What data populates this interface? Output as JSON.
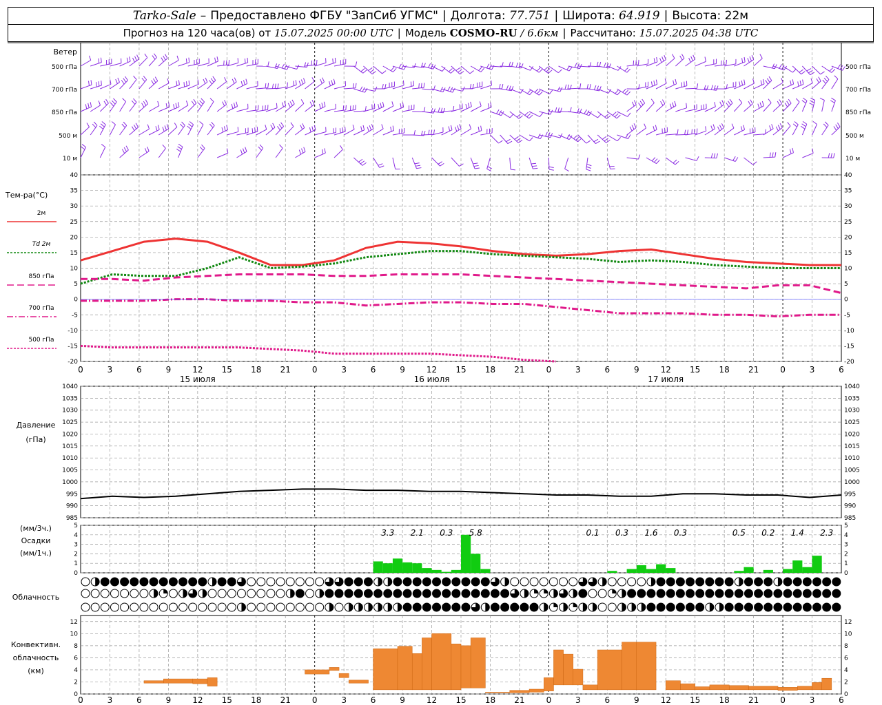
{
  "header": {
    "station": "Tarko-Sale",
    "dash": "–",
    "provider": "Предоставлено ФГБУ \"ЗапСиб УГМС\"",
    "lon_label": "Долгота:",
    "lon_value": "77.751",
    "lat_label": "Широта:",
    "lat_value": "64.919",
    "alt_label": "Высота:",
    "alt_value": "22м",
    "forecast_prefix": "Прогноз на 120 часа(ов) от",
    "forecast_start": "15.07.2025 00:00 UTC",
    "model_label": "Модель",
    "model_name": "COSMO-RU",
    "model_res": "/ 6.6км",
    "calc_label": "Рассчитано:",
    "calc_time": "15.07.2025 04:38 UTC"
  },
  "chart_data": [
    {
      "type": "barbs",
      "title": "Ветер",
      "levels": [
        "500 гПа",
        "700 гПа",
        "850 гПа",
        "500 м",
        "10 м"
      ],
      "color": "#8a2be2"
    },
    {
      "type": "line",
      "title": "Тем-ра(°С)",
      "ylim": [
        -20,
        40
      ],
      "yticks": [
        40,
        35,
        30,
        25,
        20,
        15,
        10,
        5,
        0,
        -5,
        -10,
        -15,
        -20
      ],
      "x": [
        0,
        3,
        6,
        9,
        12,
        15,
        18,
        21,
        24,
        27,
        30,
        33,
        36,
        39,
        42,
        45,
        48,
        51,
        54,
        57,
        60,
        63,
        66,
        69,
        72
      ],
      "series": [
        {
          "name": "2м",
          "color": "#ee3333",
          "style": "solid",
          "values": [
            12.5,
            15.5,
            18.5,
            19.5,
            18.5,
            15.0,
            11.0,
            11.0,
            12.5,
            16.5,
            18.5,
            18.0,
            17.0,
            15.5,
            14.5,
            14.0,
            14.5,
            15.5,
            16.0,
            14.5,
            13.0,
            12.0,
            11.5,
            11.0,
            11.0
          ]
        },
        {
          "name": "Td 2м",
          "color": "#118811",
          "style": "dotted",
          "values": [
            5.0,
            8.0,
            7.5,
            7.5,
            10.0,
            13.5,
            10.0,
            10.5,
            11.5,
            13.5,
            14.5,
            15.5,
            15.5,
            14.5,
            14.0,
            13.5,
            13.0,
            12.0,
            12.5,
            12.0,
            11.0,
            10.5,
            10.0,
            10.0,
            10.0
          ]
        },
        {
          "name": "850 гПа",
          "color": "#e0198a",
          "style": "dashed",
          "values": [
            6.5,
            6.5,
            6.0,
            7.0,
            7.5,
            8.0,
            8.0,
            8.0,
            7.5,
            7.5,
            8.0,
            8.0,
            8.0,
            7.5,
            7.0,
            6.5,
            6.0,
            5.5,
            5.0,
            4.5,
            4.0,
            3.5,
            4.5,
            4.5,
            2.0
          ]
        },
        {
          "name": "700 гПа",
          "color": "#e0198a",
          "style": "dashdot",
          "values": [
            -0.5,
            -0.5,
            -0.5,
            0.0,
            0.0,
            -0.5,
            -0.5,
            -1.0,
            -1.0,
            -2.0,
            -1.5,
            -1.0,
            -1.0,
            -1.5,
            -1.5,
            -2.5,
            -3.5,
            -4.5,
            -4.5,
            -4.5,
            -5.0,
            -5.0,
            -5.5,
            -5.0,
            -5.0
          ]
        },
        {
          "name": "500 гПа",
          "color": "#e0198a",
          "style": "dotted",
          "values": [
            -15.0,
            -15.5,
            -15.5,
            -15.5,
            -15.5,
            -15.5,
            -16.0,
            -16.5,
            -17.5,
            -17.5,
            -17.5,
            -17.5,
            -18.0,
            -18.5,
            -19.5,
            -20.0
          ]
        }
      ]
    },
    {
      "type": "line",
      "title": "Давление",
      "unit": "(гПа)",
      "ylim": [
        985,
        1040
      ],
      "yticks": [
        1040,
        1035,
        1030,
        1025,
        1020,
        1015,
        1010,
        1005,
        1000,
        995,
        990,
        985
      ],
      "x": [
        0,
        3,
        6,
        9,
        12,
        15,
        18,
        21,
        24,
        27,
        30,
        33,
        36,
        39,
        42,
        45,
        48,
        51,
        54,
        57,
        60,
        63,
        66,
        69,
        72
      ],
      "series": [
        {
          "name": "pressure",
          "color": "#000000",
          "values": [
            993,
            994,
            993.5,
            994,
            995,
            996,
            996.5,
            997,
            997,
            996.5,
            996.5,
            996,
            996,
            995.5,
            995,
            994.5,
            994.5,
            994,
            994,
            995,
            995,
            994.5,
            994.5,
            993.5,
            994.5
          ]
        }
      ]
    },
    {
      "type": "bar",
      "title": "Осадки",
      "units": [
        "(мм/3ч.)",
        "(мм/1ч.)"
      ],
      "ylim": [
        0,
        5
      ],
      "yticks": [
        5,
        4,
        3,
        2,
        1,
        0
      ],
      "color": "#11cc11",
      "x_hours": [
        30,
        31,
        32,
        33,
        34,
        35,
        36,
        37,
        38,
        39,
        40,
        41,
        42,
        53,
        54,
        56,
        57,
        58,
        59,
        60,
        61,
        62,
        67,
        68,
        69,
        70,
        72,
        73,
        74,
        75,
        76,
        77
      ],
      "values": [
        1.2,
        1.0,
        1.5,
        1.1,
        1.0,
        0.5,
        0.3,
        0.1,
        0.3,
        4.0,
        2.0,
        0.4,
        0,
        0,
        0.2,
        0.4,
        0.8,
        0.4,
        0.9,
        0.5,
        0,
        0,
        0.2,
        0.6,
        0,
        0.3,
        0.4,
        1.3,
        0.6,
        1.8,
        0,
        0
      ],
      "labels_3h": [
        {
          "x": 31.5,
          "text": "3.3"
        },
        {
          "x": 34.5,
          "text": "2.1"
        },
        {
          "x": 37.5,
          "text": "0.3"
        },
        {
          "x": 40.5,
          "text": "5.8"
        },
        {
          "x": 52.5,
          "text": "0.1"
        },
        {
          "x": 55.5,
          "text": "0.3"
        },
        {
          "x": 58.5,
          "text": "1.6"
        },
        {
          "x": 61.5,
          "text": "0.3"
        },
        {
          "x": 67.5,
          "text": "0.5"
        },
        {
          "x": 70.5,
          "text": "0.2"
        },
        {
          "x": 73.5,
          "text": "1.4"
        },
        {
          "x": 76.5,
          "text": "2.3"
        }
      ]
    },
    {
      "type": "table",
      "title": "Облачность",
      "rows": [
        {
          "name": "upper",
          "fill_by_hour": [
            0,
            0.5,
            1,
            1,
            1,
            1,
            1,
            1,
            1,
            1,
            1,
            1,
            1,
            0.5,
            1,
            1,
            0.75,
            0,
            0,
            0,
            0,
            0,
            0,
            0,
            0,
            0.75,
            0.75,
            1,
            1,
            1,
            0.5,
            0.5,
            1,
            1,
            1,
            1,
            1,
            1,
            1,
            1,
            1,
            1,
            0.75,
            0.5,
            0,
            0,
            0,
            0,
            0,
            0,
            0,
            0.75,
            0.75,
            0.5,
            0,
            0,
            0,
            0,
            0.5,
            1,
            1,
            1,
            1,
            1,
            1,
            1,
            1,
            0.5,
            1,
            1,
            1,
            0.5,
            1,
            1,
            1,
            1,
            1,
            1
          ]
        },
        {
          "name": "middle",
          "fill_by_hour": [
            0,
            0,
            0,
            0,
            0,
            0,
            0,
            0.5,
            0.25,
            0,
            0.5,
            0.75,
            0.5,
            0,
            0,
            0,
            0,
            0,
            0,
            0,
            0,
            0.5,
            1,
            0,
            0.5,
            1,
            1,
            1,
            1,
            1,
            1,
            1,
            1,
            1,
            1,
            1,
            1,
            1,
            1,
            1,
            1,
            1,
            1,
            1,
            0.75,
            0.5,
            0.25,
            0.25,
            0.5,
            0.75,
            0.5,
            1,
            0,
            0,
            0.25,
            0.5,
            1,
            1,
            1,
            1,
            1,
            1,
            1,
            1,
            1,
            1,
            1,
            1,
            1,
            1,
            1,
            1,
            1,
            1,
            1,
            1,
            1,
            1
          ]
        },
        {
          "name": "lower",
          "fill_by_hour": [
            0,
            0,
            0,
            0,
            0,
            0,
            0,
            0,
            0,
            0,
            0,
            0,
            0,
            0,
            0,
            0,
            0.5,
            0,
            0,
            0,
            0,
            0,
            0,
            0,
            0,
            0.5,
            0,
            0.5,
            0.5,
            0.5,
            0.5,
            0.5,
            0.5,
            1,
            1,
            1,
            1,
            1,
            1,
            1,
            0.75,
            0.5,
            1,
            1,
            1,
            1,
            1,
            0.5,
            0.25,
            0.5,
            0.25,
            0.5,
            0.5,
            0,
            0,
            0.5,
            0.5,
            0.5,
            1,
            1,
            1,
            1,
            1,
            1,
            0.5,
            0.5,
            1,
            1,
            1,
            1,
            1,
            1,
            1,
            1,
            1,
            1,
            1,
            1
          ]
        }
      ]
    },
    {
      "type": "bar",
      "title": "Конвективн. облачность",
      "unit": "(км)",
      "ylim": [
        0,
        13
      ],
      "yticks": [
        12,
        10,
        8,
        6,
        4,
        2,
        0
      ],
      "color": "#ee8833",
      "ranges": [
        {
          "x0": 6.5,
          "x1": 8.5,
          "lo": 1.8,
          "hi": 2.2
        },
        {
          "x0": 8.5,
          "x1": 11.5,
          "lo": 1.8,
          "hi": 2.5
        },
        {
          "x0": 11.5,
          "x1": 13.0,
          "lo": 1.7,
          "hi": 2.5
        },
        {
          "x0": 13.0,
          "x1": 14.0,
          "lo": 1.3,
          "hi": 2.7
        },
        {
          "x0": 23.0,
          "x1": 25.5,
          "lo": 3.3,
          "hi": 4.0
        },
        {
          "x0": 25.5,
          "x1": 26.5,
          "lo": 3.9,
          "hi": 4.4
        },
        {
          "x0": 26.5,
          "x1": 27.5,
          "lo": 2.7,
          "hi": 3.4
        },
        {
          "x0": 27.5,
          "x1": 29.5,
          "lo": 1.8,
          "hi": 2.3
        },
        {
          "x0": 30.0,
          "x1": 32.5,
          "lo": 0.7,
          "hi": 7.5
        },
        {
          "x0": 32.5,
          "x1": 34.0,
          "lo": 0.7,
          "hi": 7.9
        },
        {
          "x0": 34.0,
          "x1": 35.0,
          "lo": 0.7,
          "hi": 6.7
        },
        {
          "x0": 35.0,
          "x1": 36.0,
          "lo": 0.7,
          "hi": 9.3
        },
        {
          "x0": 36.0,
          "x1": 38.0,
          "lo": 0.7,
          "hi": 10.0
        },
        {
          "x0": 38.0,
          "x1": 39.0,
          "lo": 0.7,
          "hi": 8.3
        },
        {
          "x0": 39.0,
          "x1": 40.0,
          "lo": 1.0,
          "hi": 8.0
        },
        {
          "x0": 40.0,
          "x1": 41.5,
          "lo": 1.0,
          "hi": 9.3
        },
        {
          "x0": 41.5,
          "x1": 44.0,
          "lo": 0.2,
          "hi": 0.3
        },
        {
          "x0": 44.0,
          "x1": 46.0,
          "lo": 0.2,
          "hi": 0.6
        },
        {
          "x0": 46.0,
          "x1": 47.5,
          "lo": 0.3,
          "hi": 0.8
        },
        {
          "x0": 47.5,
          "x1": 48.5,
          "lo": 0.5,
          "hi": 2.7
        },
        {
          "x0": 48.5,
          "x1": 49.5,
          "lo": 1.5,
          "hi": 7.3
        },
        {
          "x0": 49.5,
          "x1": 50.5,
          "lo": 1.5,
          "hi": 6.6
        },
        {
          "x0": 50.5,
          "x1": 51.5,
          "lo": 1.5,
          "hi": 4.1
        },
        {
          "x0": 51.5,
          "x1": 53.0,
          "lo": 0.7,
          "hi": 1.5
        },
        {
          "x0": 53.0,
          "x1": 55.5,
          "lo": 0.7,
          "hi": 7.3
        },
        {
          "x0": 55.5,
          "x1": 57.0,
          "lo": 0.7,
          "hi": 8.6
        },
        {
          "x0": 57.0,
          "x1": 59.0,
          "lo": 0.7,
          "hi": 8.6
        },
        {
          "x0": 60.0,
          "x1": 61.5,
          "lo": 0.7,
          "hi": 2.2
        },
        {
          "x0": 61.5,
          "x1": 63.0,
          "lo": 0.7,
          "hi": 1.7
        },
        {
          "x0": 63.0,
          "x1": 64.5,
          "lo": 0.7,
          "hi": 1.2
        },
        {
          "x0": 64.5,
          "x1": 66.5,
          "lo": 0.7,
          "hi": 1.5
        },
        {
          "x0": 66.5,
          "x1": 68.5,
          "lo": 0.7,
          "hi": 1.4
        },
        {
          "x0": 68.5,
          "x1": 71.5,
          "lo": 0.7,
          "hi": 1.3
        },
        {
          "x0": 71.5,
          "x1": 73.5,
          "lo": 0.6,
          "hi": 1.1
        },
        {
          "x0": 73.5,
          "x1": 75.0,
          "lo": 0.7,
          "hi": 1.3
        },
        {
          "x0": 75.0,
          "x1": 76.0,
          "lo": 0.7,
          "hi": 1.9
        },
        {
          "x0": 76.0,
          "x1": 77.0,
          "lo": 0.7,
          "hi": 2.6
        }
      ]
    }
  ],
  "x_axis": {
    "tick_labels": [
      "0",
      "3",
      "6",
      "9",
      "12",
      "15",
      "18",
      "21",
      "0",
      "3",
      "6",
      "9",
      "12",
      "15",
      "18",
      "21",
      "0",
      "3",
      "6",
      "9",
      "12",
      "15",
      "18",
      "21",
      "0",
      "3",
      "6"
    ],
    "day_labels": [
      {
        "hour": 12,
        "text": "15 июля"
      },
      {
        "hour": 36,
        "text": "16 июля"
      },
      {
        "hour": 60,
        "text": "17 июля"
      }
    ]
  }
}
